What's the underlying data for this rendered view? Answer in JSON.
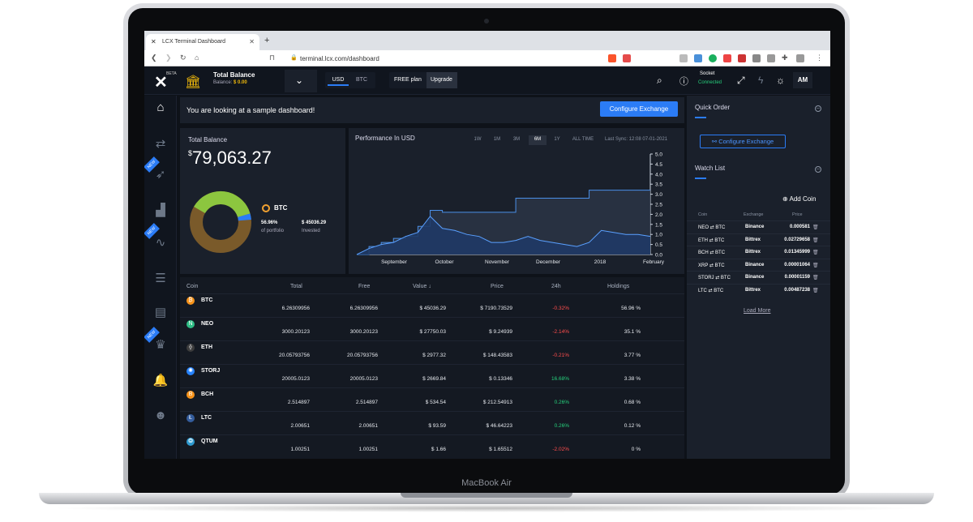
{
  "device": {
    "brand": "MacBook Air"
  },
  "browser": {
    "tab_title": "LCX Terminal Dashboard",
    "url": "terminal.lcx.com/dashboard"
  },
  "topbar": {
    "logo_beta": "BETA",
    "title": "Total Balance",
    "balance_label": "Balance:",
    "balance_value": "$ 0.00",
    "currency_options": [
      "USD",
      "BTC"
    ],
    "plan": "FREE plan",
    "upgrade": "Upgrade",
    "socket_label": "Socket",
    "socket_status": "Connected",
    "avatar": "AM"
  },
  "banner": {
    "text": "You are looking at a sample dashboard!",
    "button": "Configure Exchange"
  },
  "balance_card": {
    "title": "Total Balance",
    "currency": "$",
    "amount": "79,063.27",
    "coin": "BTC",
    "pct_value": "56.96%",
    "pct_label": "of portfolio",
    "invested_value": "$ 45036.29",
    "invested_label": "Invested",
    "donut_colors": [
      "#7a5a2a",
      "#8cc63f",
      "#2b7cf6"
    ]
  },
  "performance": {
    "title": "Performance In USD",
    "ranges": [
      "1W",
      "1M",
      "3M",
      "6M",
      "1Y",
      "ALL TIME"
    ],
    "active_range": "6M",
    "last_sync": "Last Sync: 12:08 07-01-2021",
    "x_labels": [
      "September",
      "October",
      "November",
      "December",
      "2018",
      "February"
    ],
    "y_labels": [
      "5.0",
      "4.5",
      "4.0",
      "3.5",
      "3.0",
      "2.5",
      "2.0",
      "1.5",
      "1.0",
      "0.5",
      "0.0"
    ]
  },
  "chart_data": {
    "type": "area",
    "title": "Performance In USD",
    "ylim": [
      0,
      5
    ],
    "x_ticks": [
      "September",
      "October",
      "November",
      "December",
      "2018",
      "February"
    ],
    "series": [
      {
        "values": [
          0,
          0.4,
          0.6,
          0.8,
          0.9,
          1.4,
          2.2,
          2.1,
          2.1,
          2.1,
          2.1,
          2.1,
          2.1,
          2.8,
          2.8,
          2.8,
          2.8,
          2.8,
          2.8,
          3.2,
          3.2,
          3.2,
          3.2,
          3.2,
          3.2
        ]
      },
      {
        "values": [
          0,
          0.3,
          0.5,
          0.6,
          0.9,
          1.1,
          1.9,
          1.3,
          1.2,
          1.0,
          0.9,
          0.6,
          0.6,
          0.7,
          0.9,
          0.7,
          0.6,
          0.5,
          0.4,
          0.6,
          1.2,
          1.1,
          1.0,
          1.0,
          0.9
        ]
      }
    ]
  },
  "table": {
    "headers": [
      "Coin",
      "Total",
      "Free",
      "Value",
      "Price",
      "24h",
      "Holdings"
    ],
    "rows": [
      {
        "coin": "BTC",
        "total": "6.26309956",
        "free": "6.26309956",
        "value": "$ 45036.29",
        "price": "$ 7190.73529",
        "change": "-0.32%",
        "holdings": "56.96 %",
        "color": "#f7931a",
        "glyph": "₿"
      },
      {
        "coin": "NEO",
        "total": "3000.20123",
        "free": "3000.20123",
        "value": "$ 27750.03",
        "price": "$ 9.24939",
        "change": "-2.14%",
        "holdings": "35.1 %",
        "color": "#2ebd85",
        "glyph": "N"
      },
      {
        "coin": "ETH",
        "total": "20.05793756",
        "free": "20.05793756",
        "value": "$ 2977.32",
        "price": "$ 148.43583",
        "change": "-0.21%",
        "holdings": "3.77 %",
        "color": "#3c3c3d",
        "glyph": "⟠"
      },
      {
        "coin": "STORJ",
        "total": "20005.0123",
        "free": "20005.0123",
        "value": "$ 2669.84",
        "price": "$ 0.13346",
        "change": "16.68%",
        "holdings": "3.38 %",
        "color": "#2683ff",
        "glyph": "✺"
      },
      {
        "coin": "BCH",
        "total": "2.514897",
        "free": "2.514897",
        "value": "$ 534.54",
        "price": "$ 212.54913",
        "change": "0.26%",
        "holdings": "0.68 %",
        "color": "#f7931a",
        "glyph": "B"
      },
      {
        "coin": "LTC",
        "total": "2.00651",
        "free": "2.00651",
        "value": "$ 93.59",
        "price": "$ 46.64223",
        "change": "0.26%",
        "holdings": "0.12 %",
        "color": "#345d9d",
        "glyph": "Ł"
      },
      {
        "coin": "QTUM",
        "total": "1.00251",
        "free": "1.00251",
        "value": "$ 1.66",
        "price": "$ 1.65512",
        "change": "-2.02%",
        "holdings": "0 %",
        "color": "#2e9ad0",
        "glyph": "❂"
      }
    ]
  },
  "right_panel": {
    "quick_order": "Quick Order",
    "configure": "Configure Exchange",
    "watch_list": "Watch List",
    "add_coin": "Add Coin",
    "headers": [
      "Coin",
      "Exchange",
      "Price"
    ],
    "rows": [
      {
        "coin": "NEO ⇄ BTC",
        "exchange": "Binance",
        "price": "0.000581"
      },
      {
        "coin": "ETH ⇄ BTC",
        "exchange": "Bittrex",
        "price": "0.02729658"
      },
      {
        "coin": "BCH ⇄ BTC",
        "exchange": "Bittrex",
        "price": "0.01345999"
      },
      {
        "coin": "XRP ⇄ BTC",
        "exchange": "Binance",
        "price": "0.00001064"
      },
      {
        "coin": "STORJ ⇄ BTC",
        "exchange": "Binance",
        "price": "0.00001159"
      },
      {
        "coin": "LTC ⇄ BTC",
        "exchange": "Bittrex",
        "price": "0.00487238"
      }
    ],
    "load_more": "Load More"
  }
}
